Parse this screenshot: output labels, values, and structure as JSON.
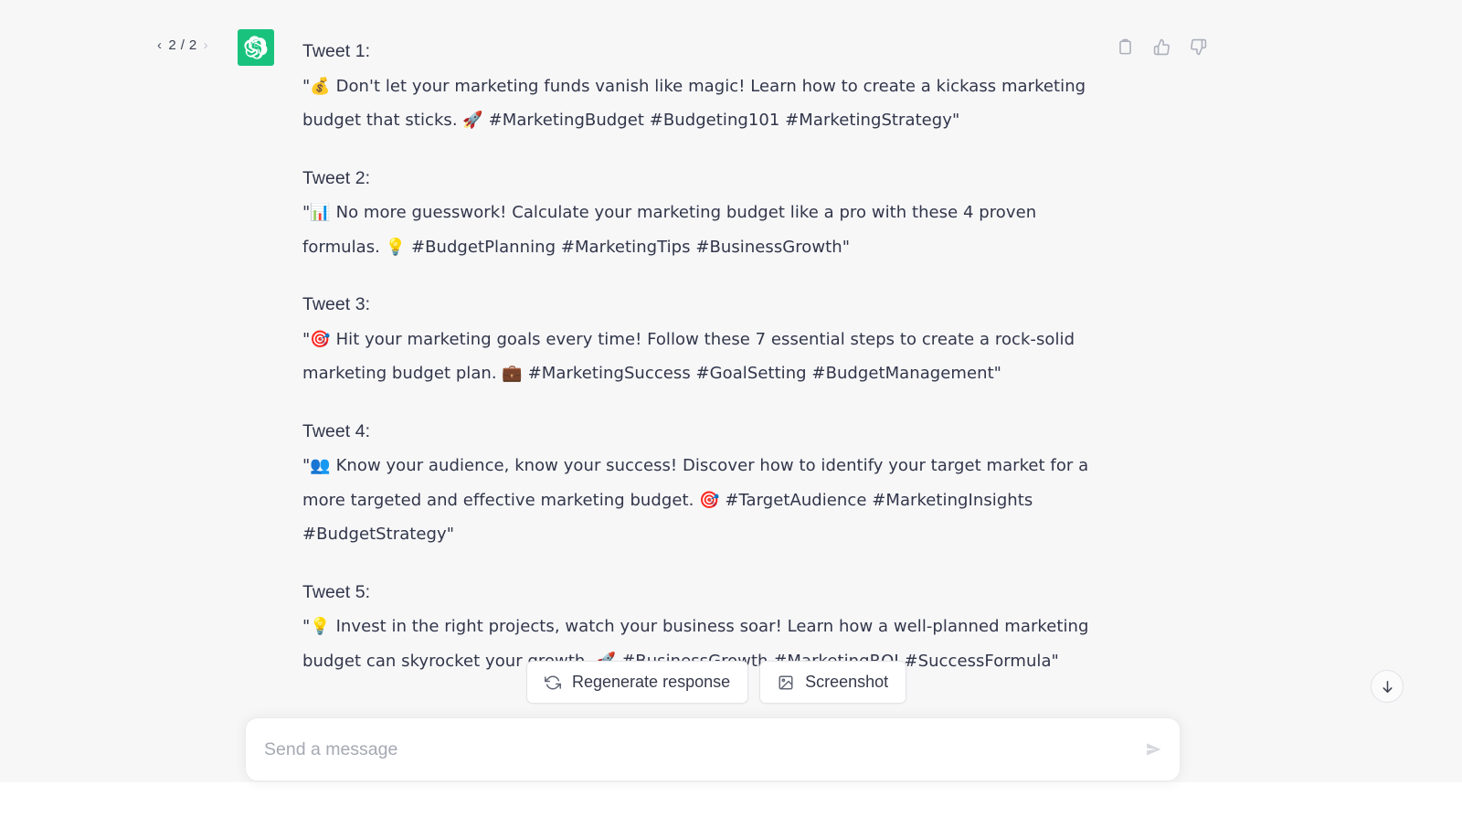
{
  "conversation": {
    "pagination": {
      "prev_icon": "chevron-left-icon",
      "next_icon": "chevron-right-icon",
      "counter": "2 / 2"
    },
    "avatar": {
      "name": "chatgpt-logo-icon",
      "color": "#19C37D"
    },
    "actions": [
      {
        "name": "copy-icon",
        "label": "Copy"
      },
      {
        "name": "thumbs-up-icon",
        "label": "Good response"
      },
      {
        "name": "thumbs-down-icon",
        "label": "Bad response"
      }
    ],
    "message_blocks": [
      {
        "label": "Tweet 1:",
        "text": "\"💰 Don't let your marketing funds vanish like magic! Learn how to create a kickass marketing budget that sticks. 🚀 #MarketingBudget #Budgeting101 #MarketingStrategy\""
      },
      {
        "label": "Tweet 2:",
        "text": "\"📊 No more guesswork! Calculate your marketing budget like a pro with these 4 proven formulas. 💡 #BudgetPlanning #MarketingTips #BusinessGrowth\""
      },
      {
        "label": "Tweet 3:",
        "text": "\"🎯 Hit your marketing goals every time! Follow these 7 essential steps to create a rock-solid marketing budget plan. 💼 #MarketingSuccess #GoalSetting #BudgetManagement\""
      },
      {
        "label": "Tweet 4:",
        "text": "\"👥 Know your audience, know your success! Discover how to identify your target market for a more targeted and effective marketing budget. 🎯 #TargetAudience #MarketingInsights #BudgetStrategy\""
      },
      {
        "label": "Tweet 5:",
        "text": "\"💡 Invest in the right projects, watch your business soar! Learn how a well-planned marketing budget can skyrocket your growth. 🚀 #BusinessGrowth #MarketingROI #SuccessFormula\""
      }
    ]
  },
  "response_actions": [
    {
      "name": "regenerate-response-button",
      "label": "Regenerate response",
      "icon": "refresh-icon"
    },
    {
      "name": "screenshot-button",
      "label": "Screenshot",
      "icon": "image-icon"
    }
  ],
  "scroll_bottom": {
    "name": "scroll-to-bottom-button",
    "icon": "arrow-down-icon"
  },
  "composer": {
    "placeholder": "Send a message",
    "value": "",
    "send_icon": "send-arrow-icon"
  },
  "colors": {
    "surface": "#F7F7F8",
    "accent": "#19C37D",
    "text": "#31364A",
    "muted": "#A6A9B2"
  }
}
